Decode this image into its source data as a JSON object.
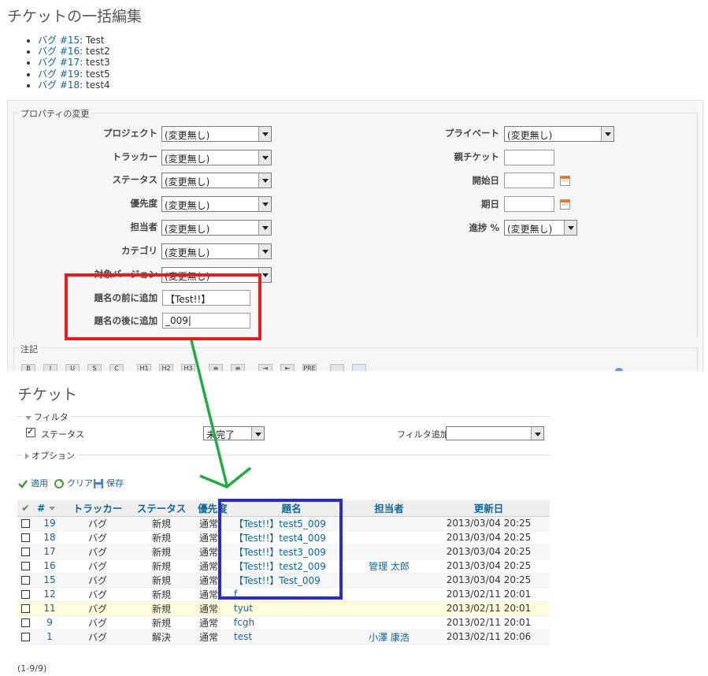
{
  "bulk_edit": {
    "title": "チケットの一括編集",
    "issues": [
      {
        "link": "バグ #15",
        "subject": ": Test"
      },
      {
        "link": "バグ #16",
        "subject": ": test2"
      },
      {
        "link": "バグ #17",
        "subject": ": test3"
      },
      {
        "link": "バグ #19",
        "subject": ": test5"
      },
      {
        "link": "バグ #18",
        "subject": ": test4"
      }
    ],
    "properties_legend": "プロパティの変更",
    "left_fields": [
      {
        "label": "プロジェクト",
        "value": "(変更無し)"
      },
      {
        "label": "トラッカー",
        "value": "(変更無し)"
      },
      {
        "label": "ステータス",
        "value": "(変更無し)"
      },
      {
        "label": "優先度",
        "value": "(変更無し)"
      },
      {
        "label": "担当者",
        "value": "(変更無し)"
      },
      {
        "label": "カテゴリ",
        "value": "(変更無し)"
      },
      {
        "label": "対象バージョン",
        "value": "(変更無し)"
      }
    ],
    "right_fields": {
      "private_label": "プライベート",
      "private_value": "(変更無し)",
      "parent_label": "親チケット",
      "parent_value": "",
      "start_label": "開始日",
      "start_value": "",
      "due_label": "期日",
      "due_value": "",
      "done_label": "進捗 %",
      "done_value": "(変更無し)"
    },
    "prefix_label": "題名の前に追加",
    "prefix_value": "【Test!!】",
    "suffix_label": "題名の後に追加",
    "suffix_value": "_009|",
    "notes_legend": "注記",
    "toolbar_buttons": [
      "B",
      "I",
      "U",
      "S",
      "C",
      "H1",
      "H2",
      "H3",
      "≡",
      "≡",
      "⇥",
      "⇤",
      "PRE",
      "",
      ""
    ],
    "annotation_color": "#e21e1e"
  },
  "issues_page": {
    "title": "チケット",
    "filter_legend": "フィルタ",
    "status_label": "ステータス",
    "status_filter_value": "未完了",
    "add_filter_label": "フィルタ追加",
    "add_filter_value": "",
    "options_legend": "オプション",
    "apply_label": "適用",
    "clear_label": "クリア",
    "save_label": "保存",
    "columns": [
      "✔",
      "#",
      "トラッカー",
      "ステータス",
      "優先度",
      "題名",
      "担当者",
      "更新日"
    ],
    "rows": [
      {
        "id": "19",
        "tracker": "バグ",
        "status": "新規",
        "priority": "通常",
        "subject": "【Test!!】test5_009",
        "assignee": "",
        "updated": "2013/03/04 20:25"
      },
      {
        "id": "18",
        "tracker": "バグ",
        "status": "新規",
        "priority": "通常",
        "subject": "【Test!!】test4_009",
        "assignee": "",
        "updated": "2013/03/04 20:25"
      },
      {
        "id": "17",
        "tracker": "バグ",
        "status": "新規",
        "priority": "通常",
        "subject": "【Test!!】test3_009",
        "assignee": "",
        "updated": "2013/03/04 20:25"
      },
      {
        "id": "16",
        "tracker": "バグ",
        "status": "新規",
        "priority": "通常",
        "subject": "【Test!!】test2_009",
        "assignee": "管理 太郎",
        "updated": "2013/03/04 20:25"
      },
      {
        "id": "15",
        "tracker": "バグ",
        "status": "新規",
        "priority": "通常",
        "subject": "【Test!!】Test_009",
        "assignee": "",
        "updated": "2013/03/04 20:25"
      },
      {
        "id": "12",
        "tracker": "バグ",
        "status": "新規",
        "priority": "通常",
        "subject": "f",
        "assignee": "",
        "updated": "2013/02/11 20:01"
      },
      {
        "id": "11",
        "tracker": "バグ",
        "status": "新規",
        "priority": "通常",
        "subject": "tyut",
        "assignee": "",
        "updated": "2013/02/11 20:01"
      },
      {
        "id": "9",
        "tracker": "バグ",
        "status": "新規",
        "priority": "通常",
        "subject": "fcgh",
        "assignee": "",
        "updated": "2013/02/11 20:01"
      },
      {
        "id": "1",
        "tracker": "バグ",
        "status": "解決",
        "priority": "通常",
        "subject": "test",
        "assignee": "小澤 康浩",
        "updated": "2013/02/11 20:06"
      }
    ],
    "pagination": "(1-9/9)",
    "highlight_color": "#2b2bc7",
    "arrow_color": "#22aa44"
  }
}
